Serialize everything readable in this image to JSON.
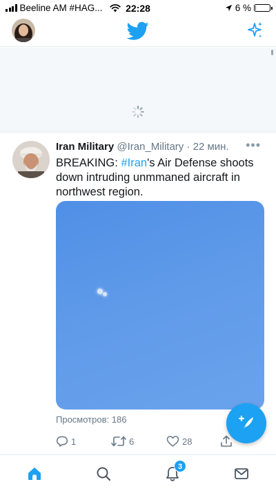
{
  "status_bar": {
    "carrier": "Beeline AM #HAG...",
    "time": "22:28",
    "battery_percent": "6 %",
    "battery_level": 0.06,
    "icons": [
      "signal-icon",
      "wifi-icon",
      "location-arrow-icon",
      "battery-icon"
    ]
  },
  "nav": {
    "logo_icon": "twitter-bird-icon",
    "sparkle_icon": "sparkle-icon",
    "avatar": "avatar"
  },
  "tweet": {
    "author_name": "Iran Military",
    "author_handle": "@Iran_Military",
    "separator": " · ",
    "time_ago": "22 мин.",
    "more": "•••",
    "text_before": "BREAKING: ",
    "hashtag": "#Iran",
    "text_after": "'s Air Defense shoots down intruding unmmaned aircraft in northwest region.",
    "views": "Просмотров: 186",
    "replies": "1",
    "retweets": "6",
    "likes": "28"
  },
  "tabs": {
    "items": [
      "home-icon",
      "search-icon",
      "notifications-icon",
      "messages-icon"
    ],
    "notifications_badge": "3"
  },
  "colors": {
    "accent": "#1da1f2",
    "text": "#14171a",
    "muted": "#657786",
    "battery_low": "#e0245e"
  }
}
